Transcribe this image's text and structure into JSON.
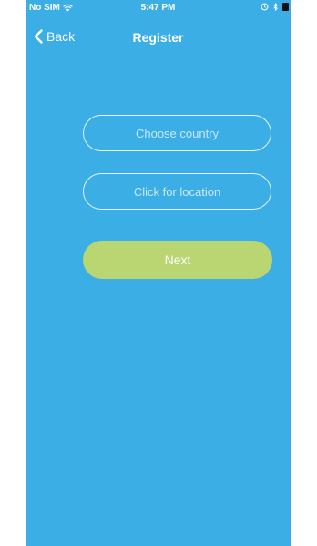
{
  "status_bar": {
    "carrier": "No SIM",
    "time": "5:47 PM",
    "icons": [
      "wifi-icon",
      "alarm-icon",
      "bluetooth-icon",
      "battery-icon"
    ]
  },
  "nav": {
    "back_label": "Back",
    "title": "Register"
  },
  "form": {
    "country_placeholder": "Choose country",
    "location_placeholder": "Click for location",
    "next_label": "Next"
  },
  "colors": {
    "background": "#3caee6",
    "next_button": "#b9d673",
    "text": "#ffffff"
  }
}
